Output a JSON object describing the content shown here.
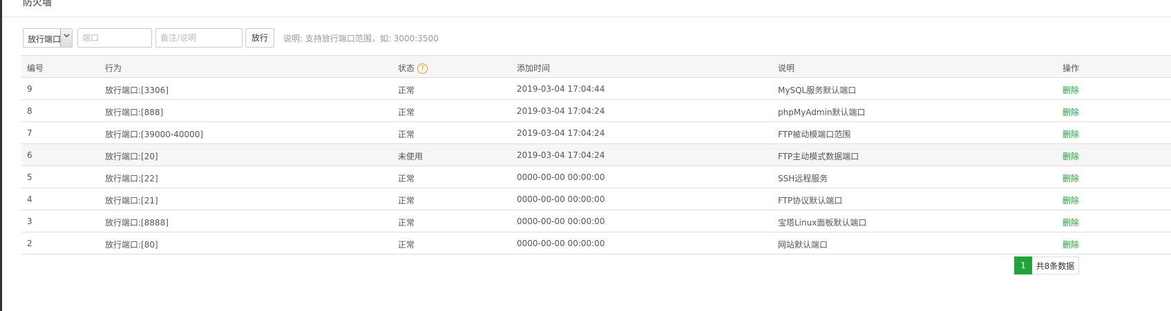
{
  "header": {
    "title": "防火墙"
  },
  "toolbar": {
    "type_select": "放行端口",
    "port_placeholder": "端口",
    "note_placeholder": "备注/说明",
    "submit_label": "放行",
    "hint": "说明: 支持放行端口范围，如: 3000:3500"
  },
  "table": {
    "columns": [
      "编号",
      "行为",
      "状态",
      "添加时间",
      "说明",
      "操作"
    ],
    "rows": [
      {
        "id": "9",
        "action": "放行端口:[3306]",
        "status": "正常",
        "time": "2019-03-04 17:04:44",
        "desc": "MySQL服务默认端口",
        "op": "删除"
      },
      {
        "id": "8",
        "action": "放行端口:[888]",
        "status": "正常",
        "time": "2019-03-04 17:04:24",
        "desc": "phpMyAdmin默认端口",
        "op": "删除"
      },
      {
        "id": "7",
        "action": "放行端口:[39000-40000]",
        "status": "正常",
        "time": "2019-03-04 17:04:24",
        "desc": "FTP被动模端口范围",
        "op": "删除"
      },
      {
        "id": "6",
        "action": "放行端口:[20]",
        "status": "未使用",
        "time": "2019-03-04 17:04:24",
        "desc": "FTP主动模式数据端口",
        "op": "删除"
      },
      {
        "id": "5",
        "action": "放行端口:[22]",
        "status": "正常",
        "time": "0000-00-00 00:00:00",
        "desc": "SSH远程服务",
        "op": "删除"
      },
      {
        "id": "4",
        "action": "放行端口:[21]",
        "status": "正常",
        "time": "0000-00-00 00:00:00",
        "desc": "FTP协议默认端口",
        "op": "删除"
      },
      {
        "id": "3",
        "action": "放行端口:[8888]",
        "status": "正常",
        "time": "0000-00-00 00:00:00",
        "desc": "宝塔Linux面板默认端口",
        "op": "删除"
      },
      {
        "id": "2",
        "action": "放行端口:[80]",
        "status": "正常",
        "time": "0000-00-00 00:00:00",
        "desc": "网站默认端口",
        "op": "删除"
      }
    ]
  },
  "pagination": {
    "current": "1",
    "total_text": "共8条数据"
  },
  "colors": {
    "accent": "#20a53a",
    "help": "#e8a000"
  },
  "icons": {
    "select_caret": "chevron-down-icon",
    "status_help": "question-icon"
  }
}
